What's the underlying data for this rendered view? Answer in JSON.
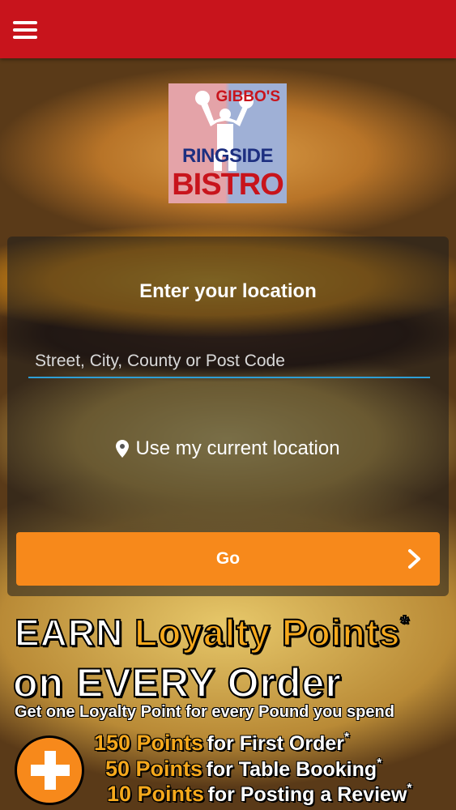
{
  "header": {
    "menu_icon": "hamburger-menu-icon",
    "bar_color": "#c8141c"
  },
  "logo": {
    "line1": "GIBBO'S",
    "line2": "RINGSIDE",
    "line3": "BISTRO"
  },
  "location": {
    "title": "Enter your location",
    "input_placeholder": "Street, City, County or Post Code",
    "input_value": "",
    "use_current_label": "Use my current location",
    "go_label": "Go",
    "accent_color": "#f7891b"
  },
  "promo": {
    "earn": "EARN",
    "loyalty_points": "Loyalty Points",
    "asterisk": "*",
    "line2": "on EVERY Order",
    "line3": "Get one Loyalty Point for every Pound you spend",
    "items": [
      {
        "points": "150 Points",
        "desc": "for First Order",
        "mark": "*"
      },
      {
        "points": "50 Points",
        "desc": "for Table Booking",
        "mark": "*"
      },
      {
        "points": "10 Points",
        "desc": "for Posting a Review",
        "mark": "*"
      }
    ]
  }
}
